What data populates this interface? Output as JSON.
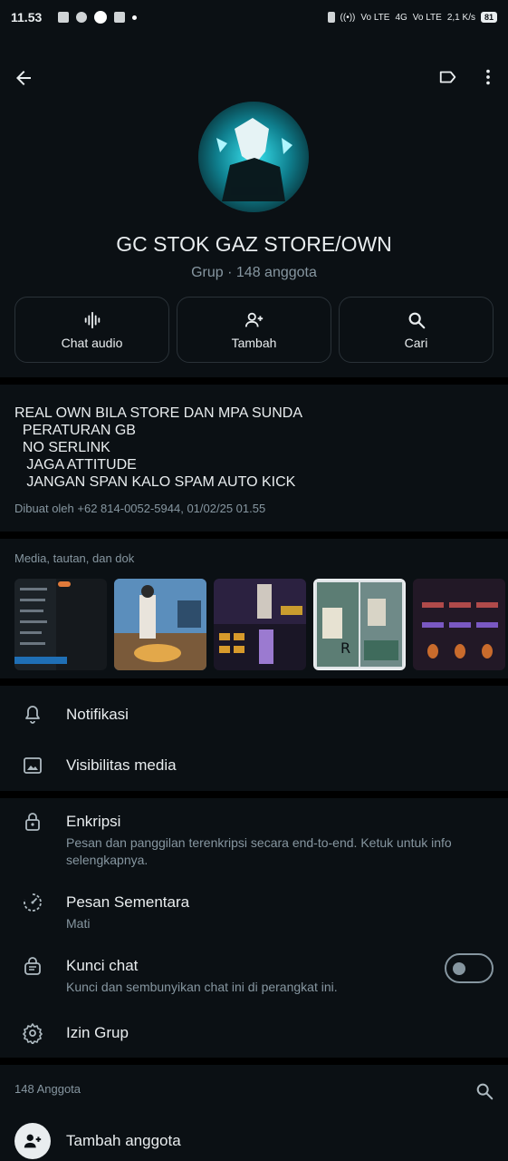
{
  "status_bar": {
    "time": "11.53",
    "network_labels": [
      "Vo LTE",
      "4G",
      "Vo LTE"
    ],
    "speed": "2,1 K/s",
    "battery": "81"
  },
  "header": {
    "back_icon": "arrow-left-icon",
    "label_icon": "label-icon",
    "more_icon": "more-vertical-icon"
  },
  "group": {
    "name": "GC STOK GAZ STORE/OWN",
    "subtitle": "Grup · 148 anggota"
  },
  "actions": [
    {
      "label": "Chat audio",
      "icon": "audio-wave-icon"
    },
    {
      "label": "Tambah",
      "icon": "add-person-icon"
    },
    {
      "label": "Cari",
      "icon": "search-icon"
    }
  ],
  "description": {
    "lines": [
      "REAL OWN BILA STORE DAN MPA SUNDA",
      "  PERATURAN GB",
      "  NO SERLINK",
      "   JAGA ATTITUDE",
      "   JANGAN SPAN KALO SPAM AUTO KICK"
    ],
    "created": "Dibuat oleh +62 814-0052-5944, 01/02/25 01.55"
  },
  "media": {
    "title": "Media, tautan, dan dok",
    "thumbnails": [
      "thumb-1",
      "thumb-2",
      "thumb-3",
      "thumb-4",
      "thumb-5",
      "thumb-6"
    ]
  },
  "settings": {
    "notifications": "Notifikasi",
    "media_visibility": "Visibilitas media",
    "encryption": {
      "title": "Enkripsi",
      "subtitle": "Pesan dan panggilan terenkripsi secara end-to-end. Ketuk untuk info selengkapnya."
    },
    "disappearing": {
      "title": "Pesan Sementara",
      "subtitle": "Mati"
    },
    "chat_lock": {
      "title": "Kunci chat",
      "subtitle": "Kunci dan sembunyikan chat ini di perangkat ini.",
      "enabled": false
    },
    "group_permissions": "Izin Grup"
  },
  "members": {
    "header": "148 Anggota",
    "add_label": "Tambah anggota"
  },
  "colors": {
    "background": "#0b1014",
    "separator": "#000000",
    "primary_text": "#e9edef",
    "secondary_text": "#8696a0",
    "border": "#2a3238"
  }
}
